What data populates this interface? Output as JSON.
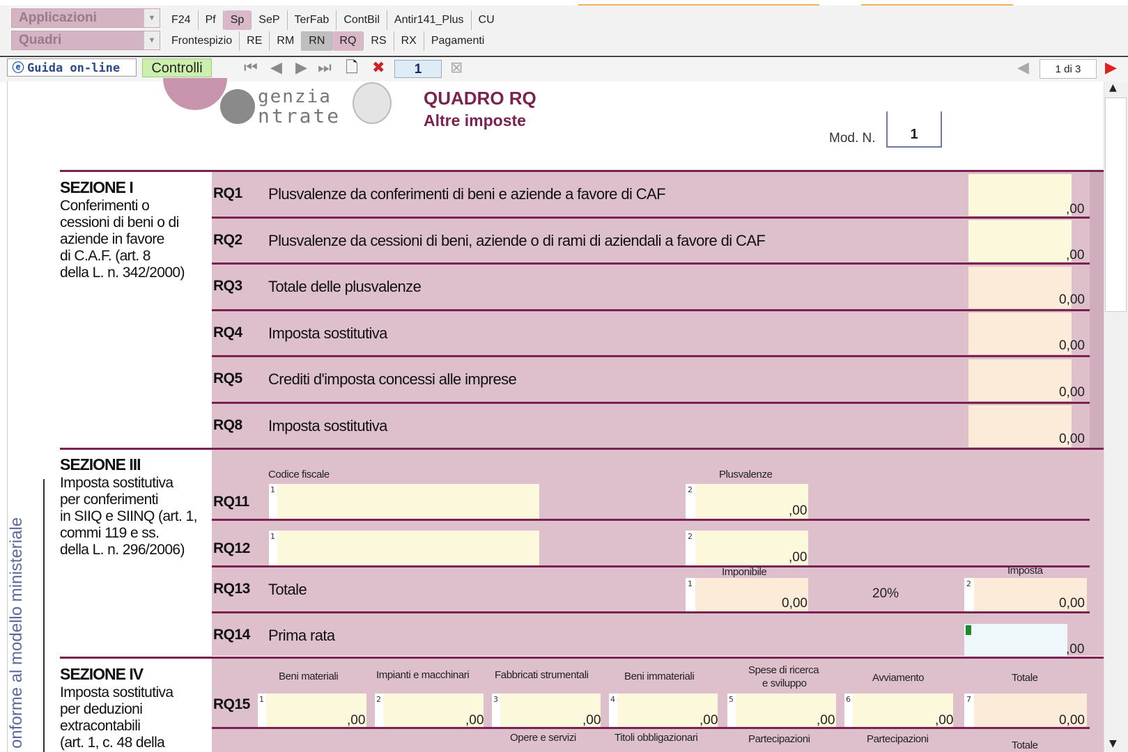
{
  "toolbar": {
    "applicazioni": "Applicazioni",
    "quadri": "Quadri",
    "tabs_top": [
      "F24",
      "Pf",
      "Sp",
      "SeP",
      "TerFab",
      "ContBil",
      "Antir141_Plus",
      "CU"
    ],
    "tabs_quadri": [
      "Frontespizio",
      "RE",
      "RM",
      "RN",
      "RQ",
      "RS",
      "RX",
      "Pagamenti"
    ],
    "guida": "Guida on-line",
    "controlli": "Controlli",
    "page_input": "1",
    "page_count": "1 di 3"
  },
  "header": {
    "logo_line1": "genzia",
    "logo_line2": "ntrate",
    "title": "QUADRO RQ",
    "subtitle": "Altre imposte",
    "mod_label": "Mod. N.",
    "mod_value": "1"
  },
  "side_label": "onforme al modello ministeriale",
  "sez1": {
    "title": "SEZIONE I",
    "desc": [
      "Conferimenti o",
      "cessioni di beni o  di",
      "aziende in favore",
      "di C.A.F. (art. 8",
      "della L. n. 342/2000)"
    ],
    "rows": [
      {
        "code": "RQ1",
        "label": "Plusvalenze da conferimenti di beni e aziende a favore di CAF",
        "value": ",00"
      },
      {
        "code": "RQ2",
        "label": "Plusvalenze da cessioni di beni, aziende o di rami di aziendali a favore di CAF",
        "value": ",00"
      },
      {
        "code": "RQ3",
        "label": "Totale delle plusvalenze",
        "value": "0,00"
      },
      {
        "code": "RQ4",
        "label": "Imposta sostitutiva",
        "value": "0,00"
      },
      {
        "code": "RQ5",
        "label": "Crediti d'imposta concessi alle imprese",
        "value": "0,00"
      },
      {
        "code": "RQ8",
        "label": "Imposta sostitutiva",
        "value": "0,00"
      }
    ]
  },
  "sez3": {
    "title": "SEZIONE III",
    "desc": [
      "Imposta sostitutiva",
      "per conferimenti",
      "in SIIQ e SIINQ (art. 1,",
      "commi 119 e ss.",
      "della L. n. 296/2006)"
    ],
    "col_codice": "Codice fiscale",
    "col_plus": "Plusvalenze",
    "rq11": {
      "code": "RQ11",
      "n1": "1",
      "n2": "2",
      "value": ",00"
    },
    "rq12": {
      "code": "RQ12",
      "n1": "1",
      "n2": "2",
      "value": ",00"
    },
    "rq13": {
      "code": "RQ13",
      "label": "Totale",
      "col_imponibile": "Imponibile",
      "col_imposta": "Imposta",
      "n1": "1",
      "n2": "2",
      "imponibile": "0,00",
      "rate": "20%",
      "imposta": "0,00"
    },
    "rq14": {
      "code": "RQ14",
      "label": "Prima rata",
      "value": ",00"
    }
  },
  "sez4": {
    "title": "SEZIONE IV",
    "desc": [
      "Imposta sostitutiva",
      "per deduzioni",
      "extracontabili",
      "(art. 1, c. 48 della"
    ],
    "cols": [
      "Beni materiali",
      "Impianti e macchinari",
      "Fabbricati strumentali",
      "Beni immateriali",
      "Spese di ricerca",
      "e sviluppo",
      "Avviamento",
      "Totale"
    ],
    "rq15": {
      "code": "RQ15",
      "values": [
        ",00",
        ",00",
        ",00",
        ",00",
        ",00",
        ",00",
        "0,00"
      ],
      "nums": [
        "1",
        "2",
        "3",
        "4",
        "5",
        "6",
        "7"
      ]
    },
    "cols2": [
      "Opere e servizi",
      "Titoli obbligazionari",
      "Partecipazioni",
      "Partecipazioni",
      "Totale"
    ]
  }
}
